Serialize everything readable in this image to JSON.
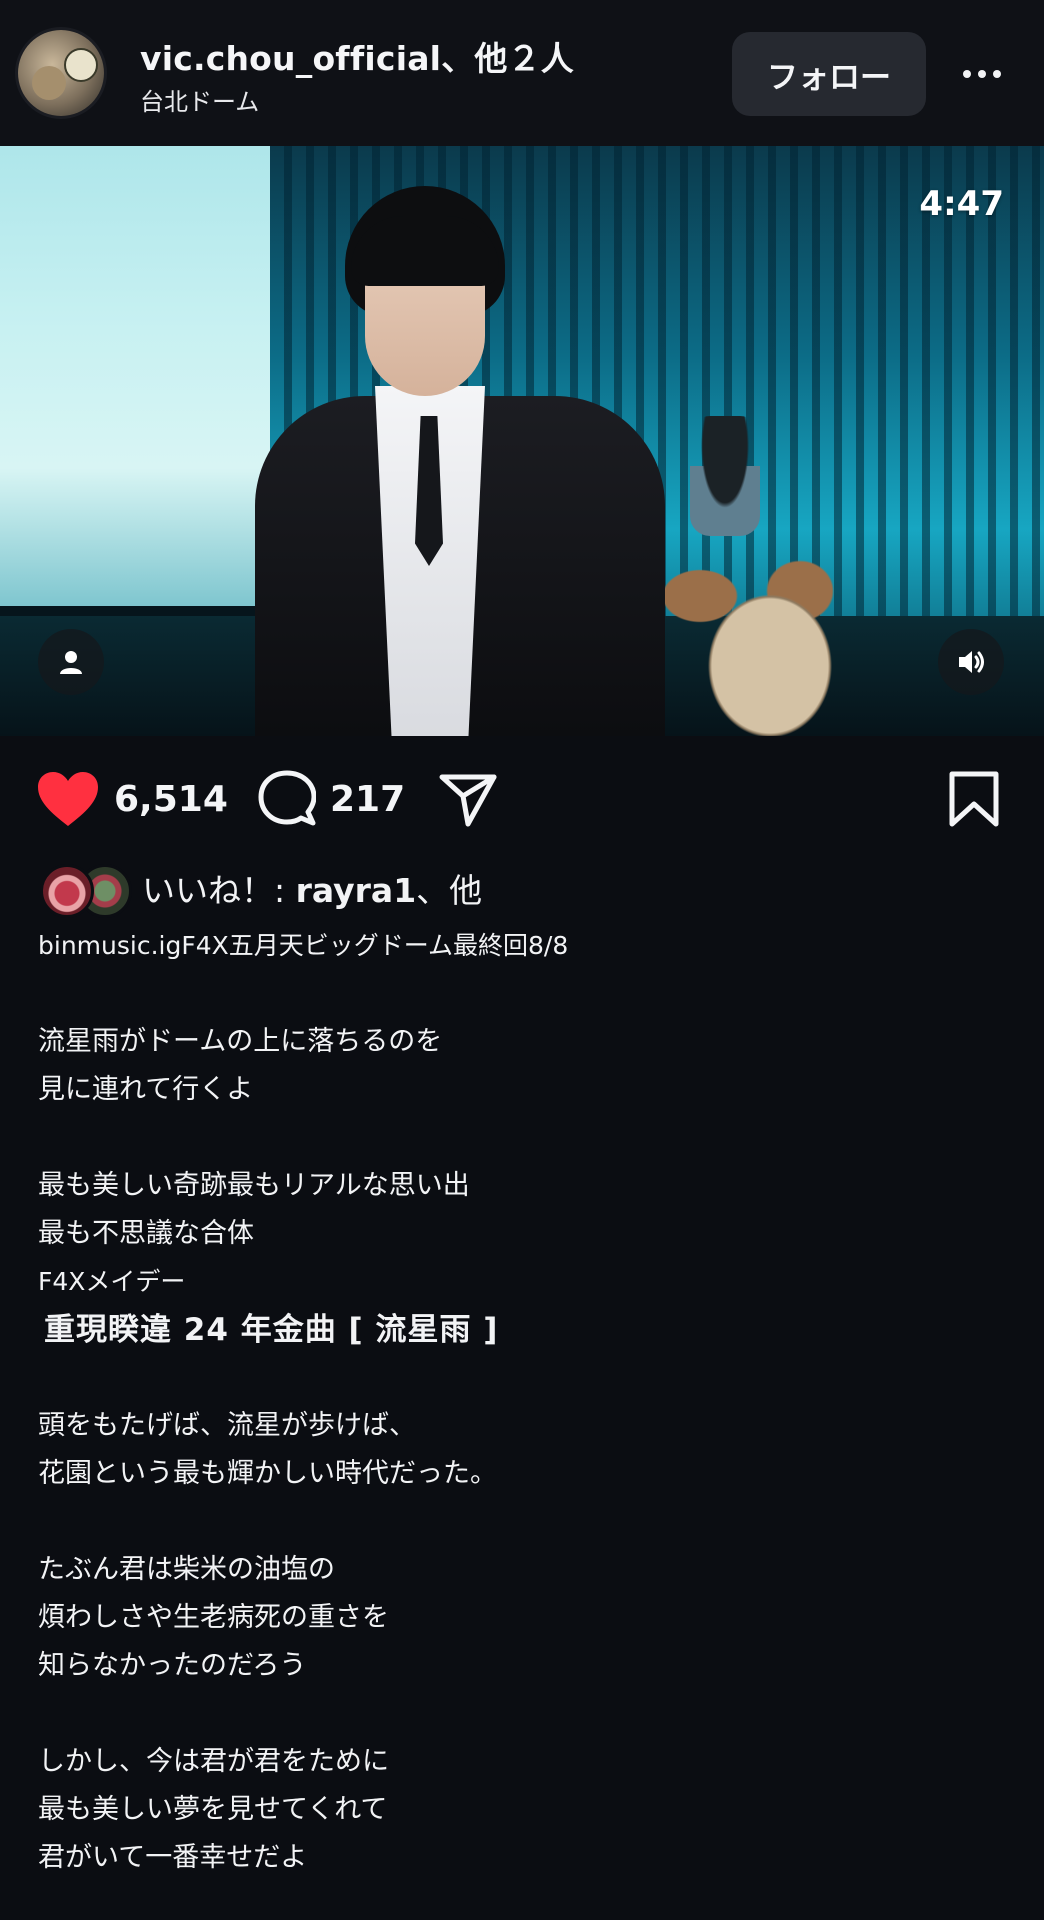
{
  "header": {
    "account_name": "vic.chou_official、他２人",
    "location": "台北ドーム",
    "follow_label": "フォロー",
    "more_icon": "more-horizontal-icon"
  },
  "media": {
    "duration": "4:47",
    "tag_icon": "user-tag-icon",
    "sound_icon": "volume-icon"
  },
  "actions": {
    "like_count": "6,514",
    "comment_count": "217",
    "like_color": "#ff3040",
    "liked": true
  },
  "liked_by": {
    "prefix": "いいね！: ",
    "user": "rayra1",
    "suffix": "、他"
  },
  "caption": {
    "lines": [
      "binmusic.igF4X五月天ビッグドーム最終回8/8",
      "",
      "流星雨がドームの上に落ちるのを",
      "見に連れて行くよ",
      "",
      "最も美しい奇跡最もリアルな思い出",
      "最も不思議な合体",
      "F4Xメイデー",
      "重現睽違 24 年金曲 [ 流星雨 ]",
      "",
      "頭をもたげば、流星が歩けば、",
      "花園という最も輝かしい時代だった。",
      "",
      "たぶん君は柴米の油塩の",
      "煩わしさや生老病死の重さを",
      "知らなかったのだろう",
      "",
      "しかし、今は君が君をために",
      "最も美しい夢を見せてくれて",
      "君がいて一番幸せだよ"
    ]
  }
}
